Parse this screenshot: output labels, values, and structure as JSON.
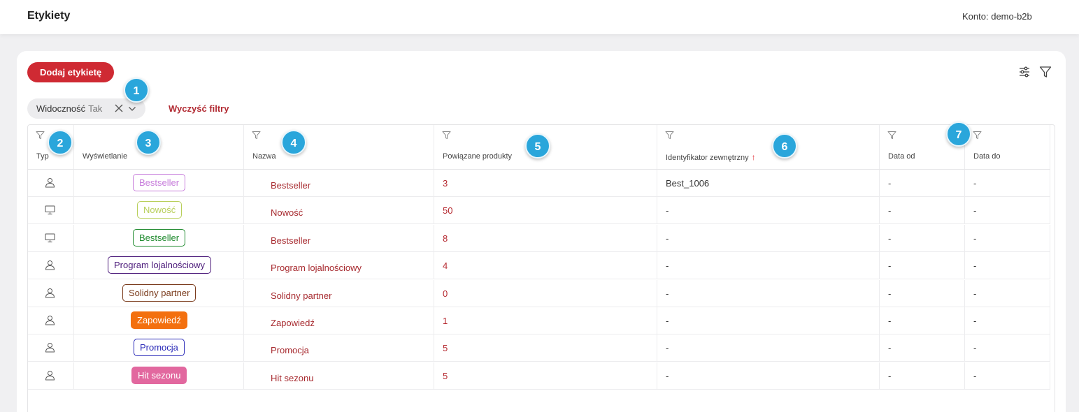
{
  "header": {
    "title": "Etykiety",
    "account_label": "Konto:",
    "account_value": "demo-b2b"
  },
  "toolbar": {
    "add_label": "Dodaj etykietę",
    "icons": [
      "sliders-icon",
      "filter-icon"
    ]
  },
  "filters": {
    "chip_label": "Widoczność",
    "chip_value": "Tak",
    "clear_label": "Wyczyść filtry"
  },
  "table": {
    "columns": [
      "Typ",
      "Wyświetlanie",
      "Nazwa",
      "Powiązane produkty",
      "Identyfikator zewnętrzny",
      "Data od",
      "Data do"
    ],
    "sort_indicator": "↑",
    "rows": [
      {
        "type": "user",
        "badge": "Bestseller",
        "badge_style": "outline",
        "badge_color": "#c77ddb",
        "name": "Bestseller",
        "count": "3",
        "ext_id": "Best_1006",
        "date_from": "-",
        "date_to": "-"
      },
      {
        "type": "monitor",
        "badge": "Nowość",
        "badge_style": "outline",
        "badge_color": "#b8cf5a",
        "name": "Nowość",
        "count": "50",
        "ext_id": "-",
        "date_from": "-",
        "date_to": "-"
      },
      {
        "type": "monitor",
        "badge": "Bestseller",
        "badge_style": "outline",
        "badge_color": "#1f8a2e",
        "name": "Bestseller",
        "count": "8",
        "ext_id": "-",
        "date_from": "-",
        "date_to": "-"
      },
      {
        "type": "user",
        "badge": "Program lojalnościowy",
        "badge_style": "outline",
        "badge_color": "#4b1a7a",
        "name": "Program lojalnościowy",
        "count": "4",
        "ext_id": "-",
        "date_from": "-",
        "date_to": "-"
      },
      {
        "type": "user",
        "badge": "Solidny partner",
        "badge_style": "outline",
        "badge_color": "#7a3b1c",
        "name": "Solidny partner",
        "count": "0",
        "ext_id": "-",
        "date_from": "-",
        "date_to": "-"
      },
      {
        "type": "user",
        "badge": "Zapowiedź",
        "badge_style": "filled",
        "badge_color": "#f3700f",
        "name": "Zapowiedź",
        "count": "1",
        "ext_id": "-",
        "date_from": "-",
        "date_to": "-"
      },
      {
        "type": "user",
        "badge": "Promocja",
        "badge_style": "outline",
        "badge_color": "#2a2ab8",
        "name": "Promocja",
        "count": "5",
        "ext_id": "-",
        "date_from": "-",
        "date_to": "-"
      },
      {
        "type": "user",
        "badge": "Hit sezonu",
        "badge_style": "filled",
        "badge_color": "#e2689f",
        "name": "Hit sezonu",
        "count": "5",
        "ext_id": "-",
        "date_from": "-",
        "date_to": "-"
      }
    ]
  },
  "annotations": [
    "1",
    "2",
    "3",
    "4",
    "5",
    "6",
    "7"
  ],
  "colors": {
    "accent": "#cf2a33",
    "link": "#b22b33",
    "bubble": "#2aa6db"
  }
}
